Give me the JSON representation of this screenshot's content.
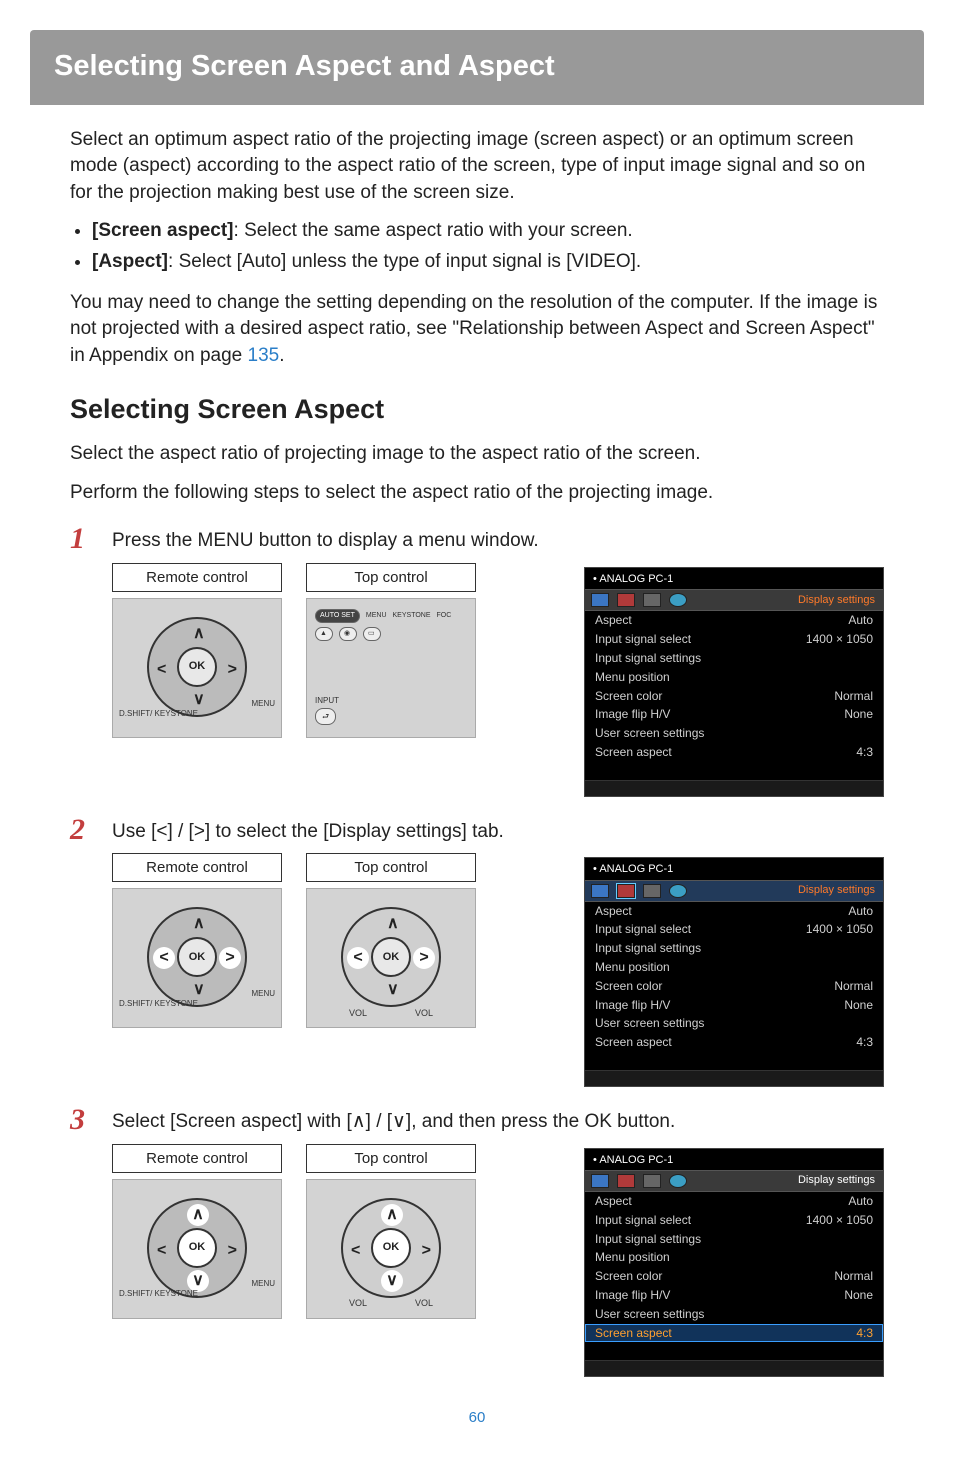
{
  "page_number": "60",
  "header_title": "Selecting Screen Aspect and Aspect",
  "intro_p1": "Select an optimum aspect ratio of the projecting image (screen aspect) or an optimum screen mode (aspect) according to the aspect ratio of the screen, type of input image signal and so on for the projection making best use of the screen size.",
  "bullets": {
    "b1_label": "[Screen aspect]",
    "b1_text": ": Select the same aspect ratio with your screen.",
    "b2_label": "[Aspect]",
    "b2_text": ": Select [Auto] unless the type of input signal is [VIDEO]."
  },
  "intro_p2_a": "You may need to change the setting depending on the resolution of the computer. If the image is not projected with a desired aspect ratio, see \"Relationship between Aspect and Screen Aspect\" in Appendix on page ",
  "intro_p2_link": "135",
  "intro_p2_b": ".",
  "section_heading": "Selecting Screen Aspect",
  "section_p1": "Select the aspect ratio of projecting image to the aspect ratio of the screen.",
  "section_p2": "Perform the following steps to select the aspect ratio of the projecting image.",
  "steps": {
    "s1": {
      "num": "1",
      "text": "Press the MENU button to display a menu window."
    },
    "s2": {
      "num": "2",
      "text": "Use [<] / [>] to select the [Display settings] tab."
    },
    "s3": {
      "num": "3",
      "text": "Select [Screen aspect] with [∧] / [∨], and then press the OK button."
    }
  },
  "control_labels": {
    "remote": "Remote control",
    "top": "Top control",
    "ok": "OK",
    "vol": "VOL",
    "menu": "MENU",
    "dshift": "D.SHIFT/\nKEYSTONE",
    "autoset": "AUTO SET",
    "keystone": "KEYSTONE",
    "foc": "FOC",
    "input": "INPUT"
  },
  "osd": {
    "source": "ANALOG PC-1",
    "tab_label_orange": "Display settings",
    "tab_label_white": "Display settings",
    "rows": [
      {
        "name": "Aspect",
        "value": "Auto"
      },
      {
        "name": "Input signal select",
        "value": "1400 × 1050"
      },
      {
        "name": "Input signal settings",
        "value": ""
      },
      {
        "name": "Menu position",
        "value": ""
      },
      {
        "name": "Screen color",
        "value": "Normal"
      },
      {
        "name": "Image flip H/V",
        "value": "None"
      },
      {
        "name": "User screen settings",
        "value": ""
      },
      {
        "name": "Screen aspect",
        "value": "4:3"
      }
    ]
  }
}
